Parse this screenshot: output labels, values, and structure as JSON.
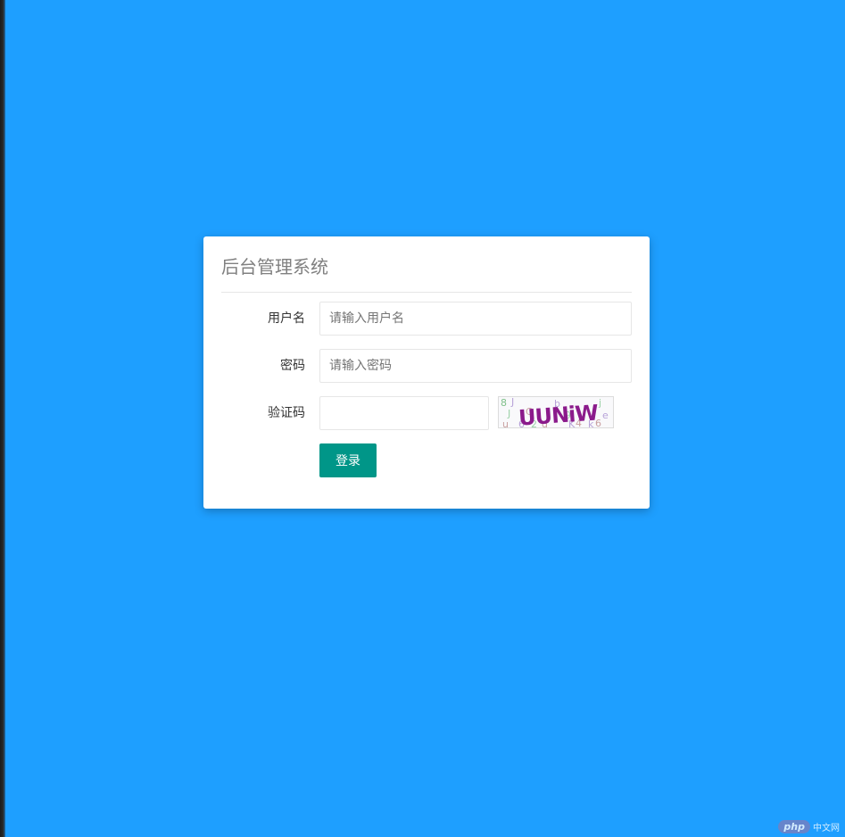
{
  "colors": {
    "background": "#1e9fff",
    "card": "#ffffff",
    "button": "#009688",
    "title": "#808080"
  },
  "login": {
    "title": "后台管理系统",
    "username": {
      "label": "用户名",
      "placeholder": "请输入用户名",
      "value": ""
    },
    "password": {
      "label": "密码",
      "placeholder": "请输入密码",
      "value": ""
    },
    "captcha": {
      "label": "验证码",
      "value": "",
      "image_icon": "captcha-image",
      "image_text": "UUNiW"
    },
    "submit_label": "登录"
  },
  "watermark": {
    "logo": "php",
    "text": "中文网"
  }
}
